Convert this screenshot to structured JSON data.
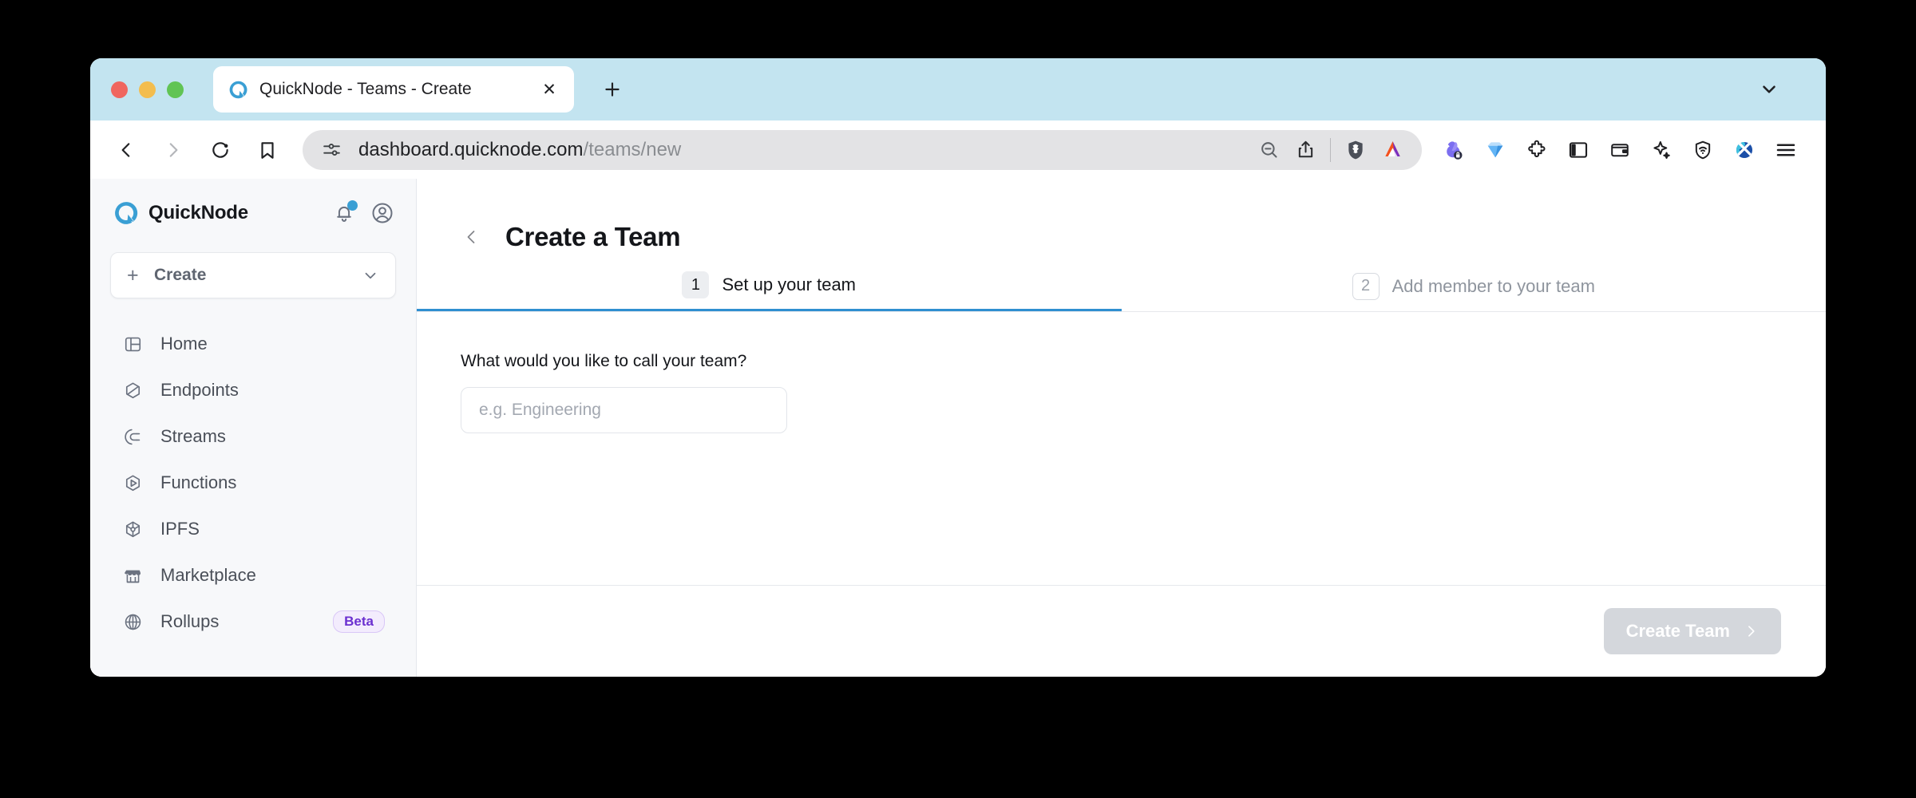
{
  "browser": {
    "tab": {
      "title": "QuickNode - Teams - Create",
      "favicon": "quicknode-q-icon",
      "close_label": "✕"
    },
    "new_tab_label": "+",
    "tabstrip_chevron": "chevron-down-icon",
    "nav": {
      "back": "back-arrow-icon",
      "forward": "forward-arrow-icon",
      "reload": "reload-icon",
      "bookmark": "bookmark-icon"
    },
    "omnibox": {
      "lead_icon": "site-settings-icon",
      "url_domain": "dashboard.quicknode.com",
      "url_path": "/teams/new",
      "actions": [
        "zoom-out-icon",
        "share-icon",
        "brave-shields-icon",
        "bat-rewards-icon"
      ]
    },
    "extensions": [
      "rabbit-wallet-icon",
      "blue-gem-icon",
      "puzzle-extensions-icon",
      "sidebar-panel-icon",
      "wallet-icon",
      "leo-sparkle-icon",
      "vpn-shield-icon",
      "x-logo-icon",
      "hamburger-menu-icon"
    ]
  },
  "sidebar": {
    "brand": "QuickNode",
    "brand_logo": "quicknode-logo-icon",
    "notifications_icon": "bell-icon",
    "account_icon": "account-avatar-icon",
    "create": {
      "plus": "+",
      "label": "Create",
      "chevron": "chevron-down-icon"
    },
    "items": [
      {
        "label": "Home",
        "icon": "layout-home-icon",
        "badge": null
      },
      {
        "label": "Endpoints",
        "icon": "hexagon-endpoints-icon",
        "badge": null
      },
      {
        "label": "Streams",
        "icon": "streams-icon",
        "badge": null
      },
      {
        "label": "Functions",
        "icon": "play-hexagon-functions-icon",
        "badge": null
      },
      {
        "label": "IPFS",
        "icon": "ipfs-icon",
        "badge": null
      },
      {
        "label": "Marketplace",
        "icon": "storefront-icon",
        "badge": null
      },
      {
        "label": "Rollups",
        "icon": "globe-icon",
        "badge": "Beta"
      }
    ]
  },
  "main": {
    "back_icon": "chevron-left-icon",
    "title": "Create a Team",
    "steps": [
      {
        "number": "1",
        "label": "Set up your team",
        "state": "active"
      },
      {
        "number": "2",
        "label": "Add member to your team",
        "state": "inactive"
      }
    ],
    "form": {
      "field_label": "What would you like to call your team?",
      "team_name_placeholder": "e.g. Engineering",
      "team_name_value": ""
    },
    "footer": {
      "submit_label": "Create Team",
      "submit_arrow": "chevron-right-icon",
      "submit_disabled": true
    }
  },
  "colors": {
    "tabstrip": "#c3e4f0",
    "accent_blue": "#2f8fd0",
    "sidebar_bg": "#f7f8fa",
    "badge_purple": "#6b30d0",
    "disabled_button": "#d4d7dc"
  }
}
